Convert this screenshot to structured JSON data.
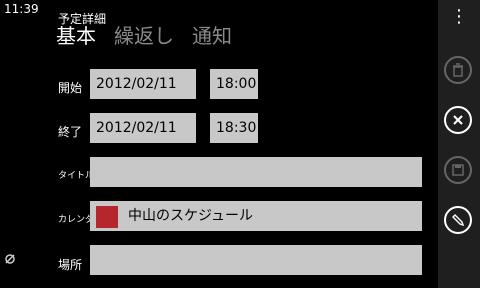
{
  "status": {
    "time": "11:39"
  },
  "header": {
    "title": "予定詳細"
  },
  "tabs": [
    {
      "label": "基本",
      "active": true
    },
    {
      "label": "繰返し",
      "active": false
    },
    {
      "label": "通知",
      "active": false
    }
  ],
  "form": {
    "start": {
      "label": "開始",
      "date": "2012/02/11",
      "time": "18:00"
    },
    "end": {
      "label": "終了",
      "date": "2012/02/11",
      "time": "18:30"
    },
    "title": {
      "label": "タイトル",
      "value": ""
    },
    "calendar": {
      "label": "カレンダ",
      "value": "中山のスケジュール",
      "color": "#b5272c"
    },
    "location": {
      "label": "場所",
      "value": ""
    }
  },
  "appbar": {
    "more_icon": "more-icon",
    "buttons": [
      {
        "icon": "delete-icon",
        "enabled": false
      },
      {
        "icon": "cancel-icon",
        "enabled": true
      },
      {
        "icon": "save-icon",
        "enabled": false
      },
      {
        "icon": "edit-icon",
        "enabled": true
      }
    ]
  }
}
